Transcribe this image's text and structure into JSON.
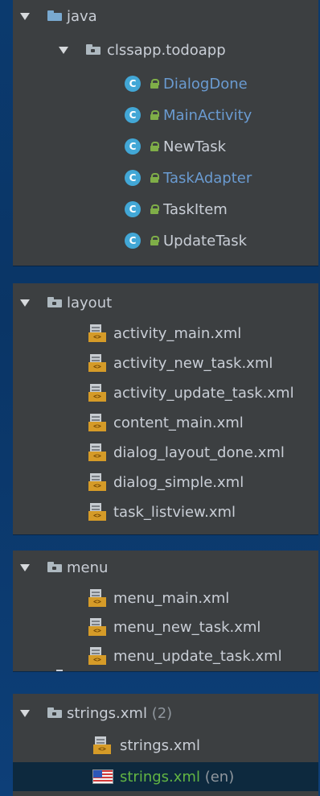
{
  "groups": {
    "java": {
      "root_label": "java",
      "package_label": "clssapp.todoapp",
      "class_icon_letter": "C",
      "classes": [
        {
          "label": "DialogDone",
          "color": "blue"
        },
        {
          "label": "MainActivity",
          "color": "blue"
        },
        {
          "label": "NewTask",
          "color": "default"
        },
        {
          "label": "TaskAdapter",
          "color": "blue"
        },
        {
          "label": "TaskItem",
          "color": "default"
        },
        {
          "label": "UpdateTask",
          "color": "default"
        }
      ]
    },
    "layout": {
      "folder_label": "layout",
      "files": [
        "activity_main.xml",
        "activity_new_task.xml",
        "activity_update_task.xml",
        "content_main.xml",
        "dialog_layout_done.xml",
        "dialog_simple.xml",
        "task_listview.xml"
      ]
    },
    "menu": {
      "folder_label": "menu",
      "files": [
        "menu_main.xml",
        "menu_new_task.xml",
        "menu_update_task.xml"
      ]
    },
    "strings": {
      "folder_label": "strings.xml",
      "folder_count": "(2)",
      "files": [
        {
          "label": "strings.xml",
          "suffix": "",
          "icon": "xml-file-icon"
        },
        {
          "label": "strings.xml",
          "suffix": "(en)",
          "icon": "us-flag-icon",
          "selected": true
        }
      ]
    }
  },
  "xml_tag_text": "<>",
  "colors": {
    "panel_bg": "#3c3f41",
    "desktop_bg": "#0b3a6e",
    "blue_label": "#6a9bd1",
    "green_label": "#62b543",
    "class_icon": "#42a7d6",
    "selected_row": "#0d293e"
  }
}
